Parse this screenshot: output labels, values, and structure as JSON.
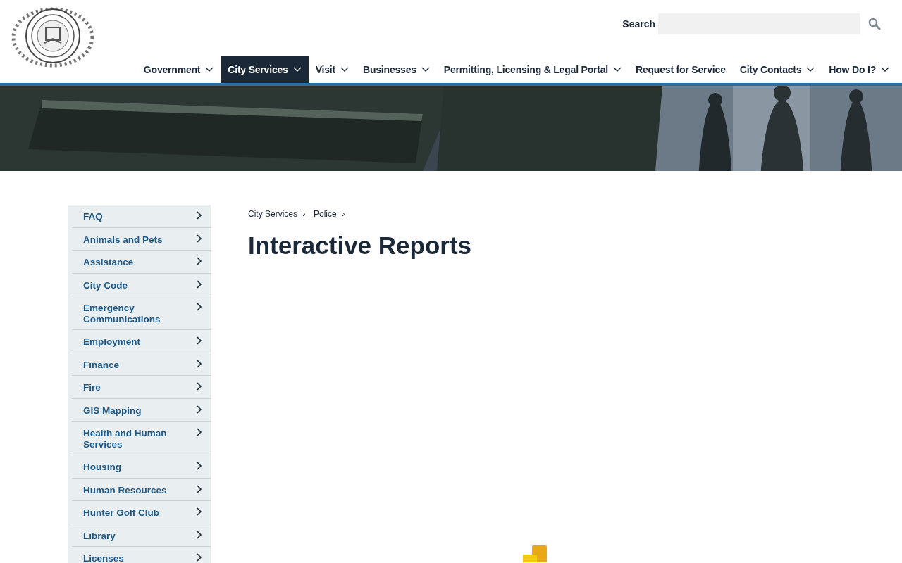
{
  "search": {
    "label": "Search"
  },
  "nav": [
    {
      "label": "Government",
      "dropdown": true,
      "selected": false
    },
    {
      "label": "City Services",
      "dropdown": true,
      "selected": true
    },
    {
      "label": "Visit",
      "dropdown": true,
      "selected": false
    },
    {
      "label": "Businesses",
      "dropdown": true,
      "selected": false
    },
    {
      "label": "Permitting, Licensing & Legal Portal",
      "dropdown": true,
      "selected": false
    },
    {
      "label": "Request for Service",
      "dropdown": false,
      "selected": false
    },
    {
      "label": "City Contacts",
      "dropdown": true,
      "selected": false
    },
    {
      "label": "How Do I?",
      "dropdown": true,
      "selected": false
    }
  ],
  "sidebar": {
    "items": [
      {
        "label": "FAQ"
      },
      {
        "label": "Animals and Pets"
      },
      {
        "label": "Assistance"
      },
      {
        "label": "City Code"
      },
      {
        "label": "Emergency Communications"
      },
      {
        "label": "Employment"
      },
      {
        "label": "Finance"
      },
      {
        "label": "Fire"
      },
      {
        "label": "GIS Mapping"
      },
      {
        "label": "Health and Human Services"
      },
      {
        "label": "Housing"
      },
      {
        "label": "Human Resources"
      },
      {
        "label": "Hunter Golf Club"
      },
      {
        "label": "Library"
      },
      {
        "label": "Licenses"
      }
    ]
  },
  "breadcrumb": [
    "City Services",
    "Police"
  ],
  "page_title": "Interactive Reports"
}
